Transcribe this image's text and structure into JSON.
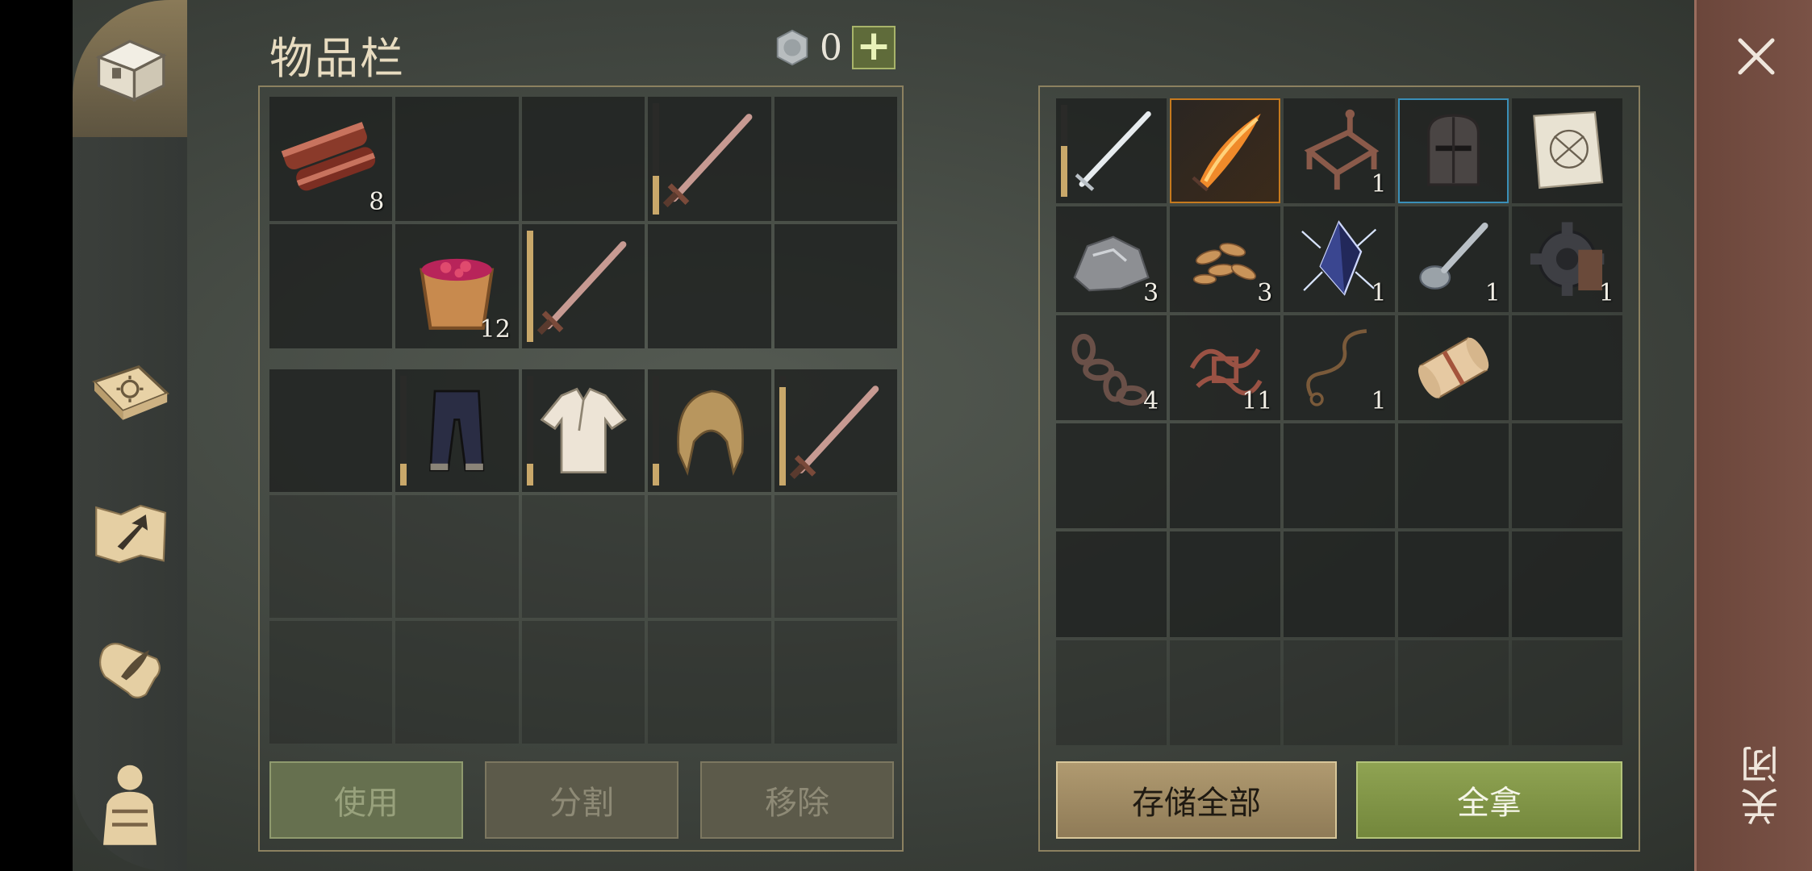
{
  "header": {
    "title": "物品栏",
    "currency": "0",
    "add_label": "+"
  },
  "nav": [
    "chest-icon",
    "journal-icon",
    "map-arrow-icon",
    "scroll-feather-icon",
    "character-icon"
  ],
  "inventory": {
    "row1": [
      {
        "icon": "bacon-icon",
        "count": "8"
      },
      {},
      {},
      {
        "icon": "sword-icon",
        "durability": 0.35
      },
      {}
    ],
    "row2": [
      {},
      {
        "icon": "berry-bucket-icon",
        "count": "12"
      },
      {
        "icon": "sword-icon",
        "durability": 1.0
      },
      {},
      {}
    ],
    "equip": [
      {},
      {
        "icon": "pants-icon",
        "durability": 0.2
      },
      {
        "icon": "shirt-icon",
        "durability": 0.2
      },
      {
        "icon": "hood-icon",
        "durability": 0.2
      },
      {
        "icon": "sword-icon",
        "durability": 0.9
      }
    ],
    "buttons": {
      "use": "使用",
      "split": "分割",
      "remove": "移除"
    }
  },
  "storage": {
    "rows": [
      [
        {
          "icon": "steel-sword-icon",
          "durability": 0.55
        },
        {
          "icon": "flaming-sword-icon",
          "highlight": "orange"
        },
        {
          "icon": "iron-frame-icon",
          "count": "1"
        },
        {
          "icon": "knight-helmet-icon",
          "highlight": "blue"
        },
        {
          "icon": "blueprint-icon"
        }
      ],
      [
        {
          "icon": "ore-icon",
          "count": "3"
        },
        {
          "icon": "seeds-icon",
          "count": "3"
        },
        {
          "icon": "crystal-icon",
          "count": "1"
        },
        {
          "icon": "spoon-icon",
          "count": "1"
        },
        {
          "icon": "gear-icon",
          "count": "1"
        }
      ],
      [
        {
          "icon": "chain-icon",
          "count": "4"
        },
        {
          "icon": "wire-scrap-icon",
          "count": "11"
        },
        {
          "icon": "rope-icon",
          "count": "1"
        },
        {
          "icon": "scroll-icon"
        },
        {}
      ],
      [
        {},
        {},
        {},
        {},
        {}
      ],
      [
        {},
        {},
        {},
        {},
        {}
      ],
      [
        {},
        {},
        {},
        {},
        {}
      ]
    ],
    "buttons": {
      "store_all": "存储全部",
      "take_all": "全拿"
    }
  },
  "close": {
    "label": "关闭"
  },
  "colors": {
    "accent_green": "#7f9443",
    "gold": "#b09a70",
    "close_strip": "#6f4a3f"
  }
}
